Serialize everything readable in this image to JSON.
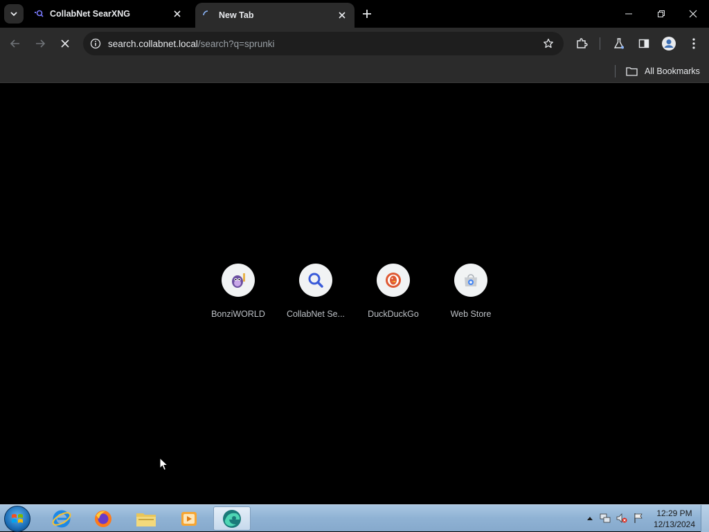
{
  "tabs": [
    {
      "title": "CollabNet SearXNG",
      "favicon": "searxng-icon",
      "active": false
    },
    {
      "title": "New Tab",
      "favicon": "spinner-icon",
      "active": true
    }
  ],
  "toolbar": {
    "url_host": "search.collabnet.local",
    "url_path": "/search?q=sprunki"
  },
  "bookmarks_bar": {
    "all_bookmarks_label": "All Bookmarks"
  },
  "shortcuts": [
    {
      "label": "BonziWORLD",
      "icon": "bonzi-icon"
    },
    {
      "label": "CollabNet Se...",
      "icon": "search-magnifier-icon"
    },
    {
      "label": "DuckDuckGo",
      "icon": "duckduckgo-icon"
    },
    {
      "label": "Web Store",
      "icon": "web-store-icon"
    }
  ],
  "taskbar": {
    "apps": [
      "internet-explorer-icon",
      "firefox-icon",
      "file-explorer-icon",
      "media-player-icon",
      "edge-beta-icon"
    ],
    "clock_time": "12:29 PM",
    "clock_date": "12/13/2024"
  },
  "colors": {
    "chrome_dark": "#2b2b2b",
    "page_background": "#000000",
    "taskbar_blue": "#8fb2d4"
  }
}
